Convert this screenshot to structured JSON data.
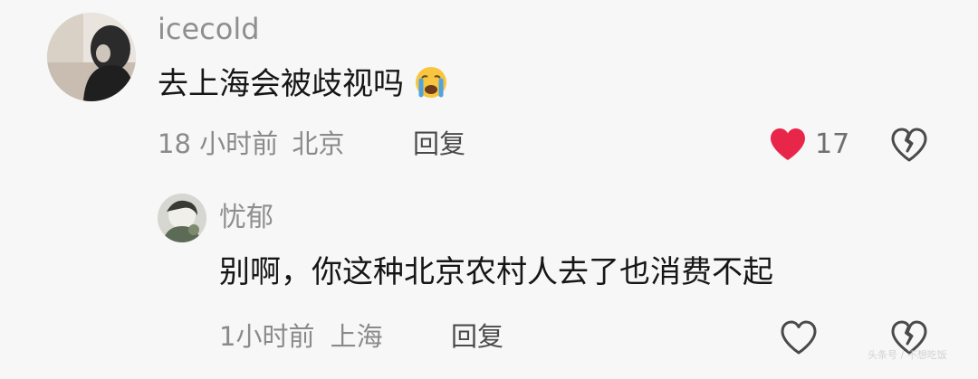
{
  "comment": {
    "username": "icecold",
    "text": "去上海会被歧视吗",
    "emoji": "crying-face-emoji",
    "time": "18 小时前",
    "location": "北京",
    "reply_label": "回复",
    "like_count": "17",
    "liked": true,
    "like_color": "#e8264a"
  },
  "reply": {
    "username": "忧郁",
    "text": "别啊，你这种北京农村人去了也消费不起",
    "time": "1小时前",
    "location": "上海",
    "reply_label": "回复"
  },
  "watermark": {
    "text": "头条号 / 不想吃饭"
  }
}
